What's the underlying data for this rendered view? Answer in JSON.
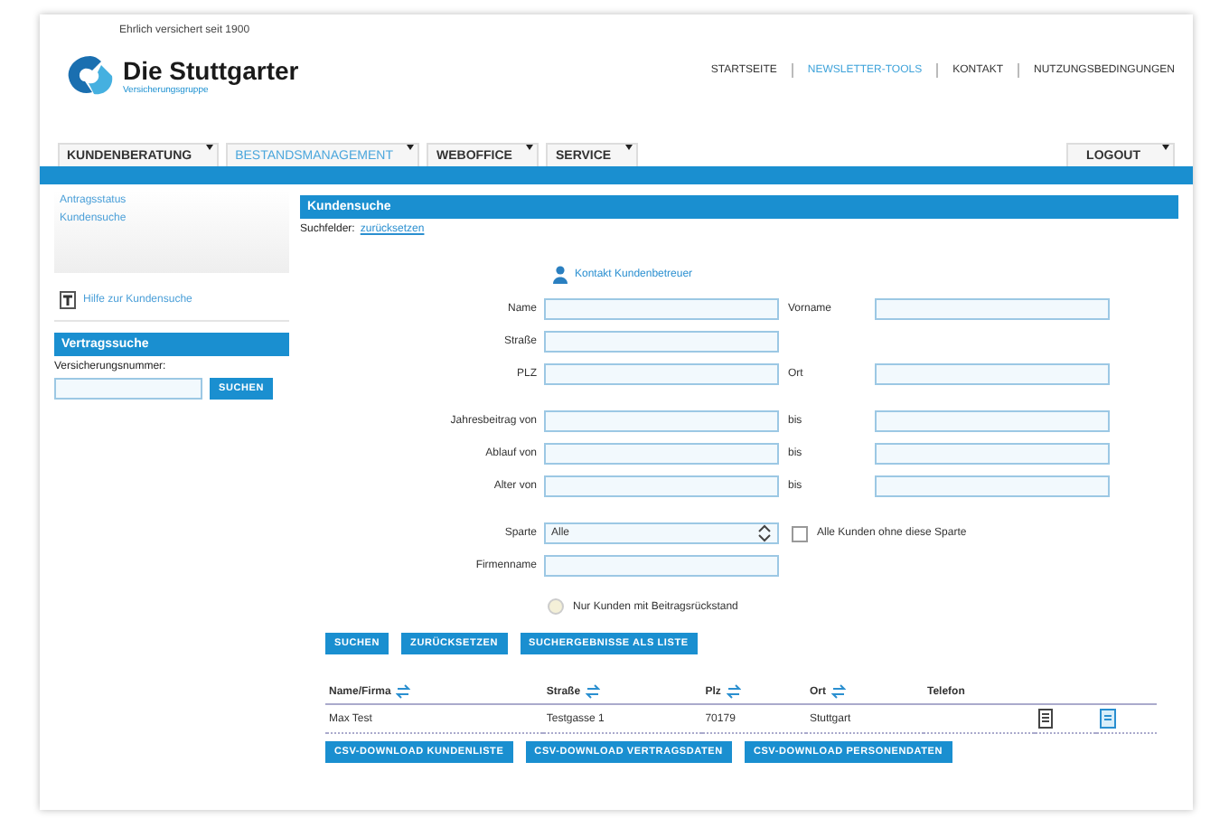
{
  "header": {
    "tagline": "Ehrlich versichert seit 1900",
    "logo": {
      "name": "Die Stuttgarter",
      "subtitle": "Versicherungsgruppe"
    },
    "top_links": [
      {
        "label": "STARTSEITE",
        "selected": false
      },
      {
        "label": "NEWSLETTER-TOOLS",
        "selected": true
      },
      {
        "label": "KONTAKT",
        "selected": false
      },
      {
        "label": "NUTZUNGSBEDINGUNGEN",
        "selected": false
      }
    ]
  },
  "nav": [
    {
      "label": "KUNDENBERATUNG",
      "selected": false
    },
    {
      "label": "BESTANDSMANAGEMENT",
      "selected": true
    },
    {
      "label": "WEBOFFICE",
      "selected": false
    },
    {
      "label": "SERVICE",
      "selected": false
    }
  ],
  "logout": "LOGOUT",
  "sidebar": {
    "links": [
      "Antragsstatus",
      "Kundensuche"
    ],
    "help_link": "Hilfe zur Kundensuche",
    "contract_search": {
      "title": "Vertragssuche",
      "label": "Versicherungsnummer:",
      "button": "SUCHEN"
    }
  },
  "main": {
    "title": "Kundensuche",
    "reset_label": "Suchfelder:",
    "reset_link": "zurücksetzen",
    "contact_link": "Kontakt Kundenbetreuer",
    "field_groups": [
      [
        {
          "kind": "text",
          "label": "Name",
          "second_label": "Vorname"
        },
        {
          "kind": "text",
          "label": "Straße"
        },
        {
          "kind": "text",
          "label": "PLZ",
          "second_label": "Ort"
        }
      ],
      [
        {
          "kind": "text",
          "label": "Jahresbeitrag von",
          "second_label": "bis"
        },
        {
          "kind": "text",
          "label": "Ablauf von",
          "second_label": "bis"
        },
        {
          "kind": "text",
          "label": "Alter von",
          "second_label": "bis"
        }
      ],
      [
        {
          "kind": "select",
          "label": "Sparte",
          "value": "Alle",
          "checkbox": {
            "label": "Alle Kunden ohne diese Sparte",
            "checked": false
          }
        },
        {
          "kind": "text",
          "label": "Firmenname"
        }
      ]
    ],
    "radio": {
      "label": "Nur Kunden mit Beitragsrückstand",
      "selected": false
    },
    "buttons": [
      "SUCHEN",
      "ZURÜCKSETZEN",
      "SUCHERGEBNISSE ALS LISTE"
    ],
    "table": {
      "columns": [
        {
          "label": "Name/Firma",
          "sortable": true
        },
        {
          "label": "Straße",
          "sortable": true
        },
        {
          "label": "Plz",
          "sortable": true
        },
        {
          "label": "Ort",
          "sortable": true
        },
        {
          "label": "Telefon",
          "sortable": false
        }
      ],
      "rows": [
        {
          "cells": [
            "Max Test",
            "Testgasse 1",
            "70179",
            "Stuttgart",
            ""
          ]
        }
      ]
    },
    "download_buttons": [
      "CSV-DOWNLOAD KUNDENLISTE",
      "CSV-DOWNLOAD VERTRAGSDATEN",
      "CSV-DOWNLOAD PERSONENDATEN"
    ]
  }
}
